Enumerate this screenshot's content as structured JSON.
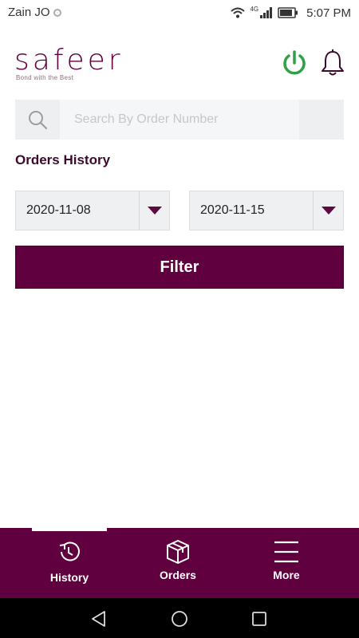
{
  "status_bar": {
    "carrier": "Zain JO",
    "network": "4G",
    "time": "5:07 PM"
  },
  "header": {
    "logo_text": "safeer",
    "logo_tagline": "Bond with the Best",
    "colors": {
      "brand": "#60003f",
      "power": "#2fa043"
    }
  },
  "search": {
    "placeholder": "Search By Order Number",
    "value": ""
  },
  "orders": {
    "title": "Orders History",
    "from_date": "2020-11-08",
    "to_date": "2020-11-15",
    "filter_label": "Filter"
  },
  "bottom_nav": {
    "items": [
      {
        "label": "History",
        "icon": "history-icon",
        "active": true
      },
      {
        "label": "Orders",
        "icon": "box-icon",
        "active": false
      },
      {
        "label": "More",
        "icon": "menu-icon",
        "active": false
      }
    ]
  },
  "system_nav": {
    "icons": [
      "back-icon",
      "home-icon",
      "recents-icon"
    ]
  }
}
